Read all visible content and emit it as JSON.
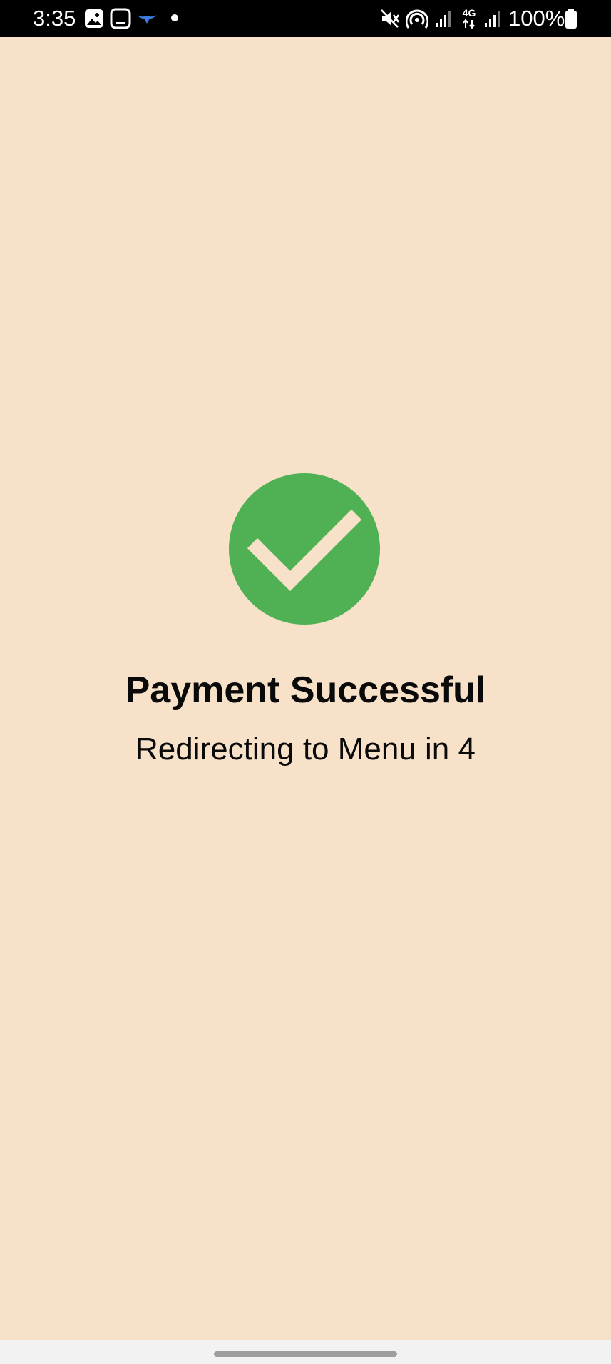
{
  "status_bar": {
    "time": "3:35",
    "battery": "100%",
    "network": "4G",
    "left_icons": [
      "gallery-icon",
      "screenshot-icon",
      "bird-app-icon",
      "dot-icon"
    ],
    "right_icons": [
      "mute-icon",
      "hotspot-icon",
      "signal-icon",
      "4g-icon",
      "signal-icon",
      "battery-icon"
    ]
  },
  "payment": {
    "title": "Payment Successful",
    "message": "Redirecting to Menu in 4",
    "icon": "check-circle-icon"
  },
  "colors": {
    "background": "#F7E1C8",
    "success_green": "#4FB153",
    "text": "#0A0A0A",
    "status_bar": "#000000"
  }
}
